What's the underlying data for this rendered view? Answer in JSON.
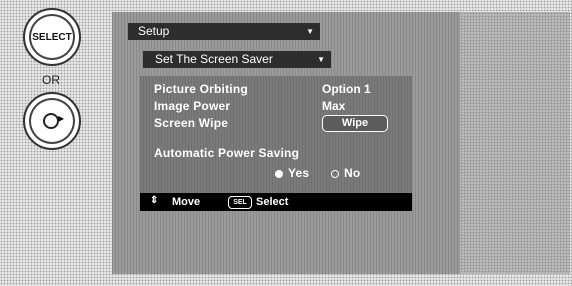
{
  "remote": {
    "select_label": "SELECT",
    "or_label": "OR",
    "dpad_icon": "dpad-right-icon"
  },
  "menu": {
    "top": "Setup",
    "sub": "Set The Screen Saver"
  },
  "settings": [
    {
      "label": "Picture Orbiting",
      "value": "Option 1"
    },
    {
      "label": "Image Power",
      "value": "Max"
    },
    {
      "label": "Screen Wipe",
      "value": "Wipe"
    }
  ],
  "power_saving": {
    "label": "Automatic Power Saving",
    "options": [
      {
        "label": "Yes",
        "selected": true
      },
      {
        "label": "No",
        "selected": false
      }
    ]
  },
  "status": {
    "move_label": "Move",
    "sel_badge": "SEL",
    "select_label": "Select"
  }
}
